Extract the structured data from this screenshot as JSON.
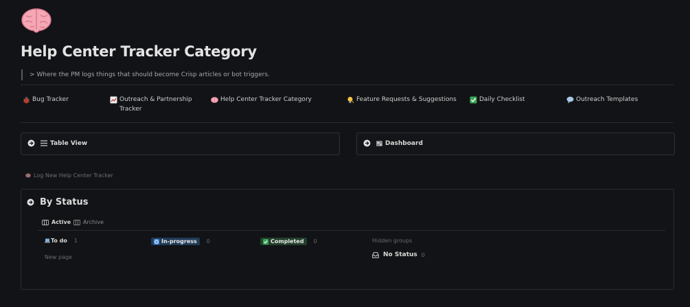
{
  "page": {
    "icon": "brain-emoji",
    "title": "Help Center Tracker Category",
    "quote": "> Where the PM logs things that should become Crisp articles or bot triggers."
  },
  "nav": [
    {
      "label": "Bug Tracker",
      "icon": "bug-icon"
    },
    {
      "label": "Outreach & Partnership Tracker",
      "icon": "chart-icon"
    },
    {
      "label": "Help Center Tracker Category",
      "icon": "brain-icon"
    },
    {
      "label": "Feature Requests & Suggestions",
      "icon": "bulb-icon"
    },
    {
      "label": "Daily Checklist",
      "icon": "checkmark-icon"
    },
    {
      "label": "Outreach Templates",
      "icon": "speech-bubble-icon"
    }
  ],
  "views": {
    "table": {
      "label": "Table View"
    },
    "dashboard": {
      "label": "Dashboard"
    }
  },
  "log_link": "Log New Help Center Tracker",
  "board": {
    "title": "By Status",
    "tabs": [
      {
        "label": "Active",
        "active": true
      },
      {
        "label": "Archive",
        "active": false
      }
    ],
    "groups": [
      {
        "label": "To do",
        "count": "1"
      },
      {
        "label": "In-progress",
        "count": "0"
      },
      {
        "label": "Completed",
        "count": "0"
      }
    ],
    "new_page": "New page",
    "hidden_groups": "Hidden groups",
    "no_status": {
      "label": "No Status",
      "count": "0"
    }
  },
  "colors": {
    "background": "#121316",
    "in_progress": "#1f3b57",
    "completed": "#22402c"
  }
}
